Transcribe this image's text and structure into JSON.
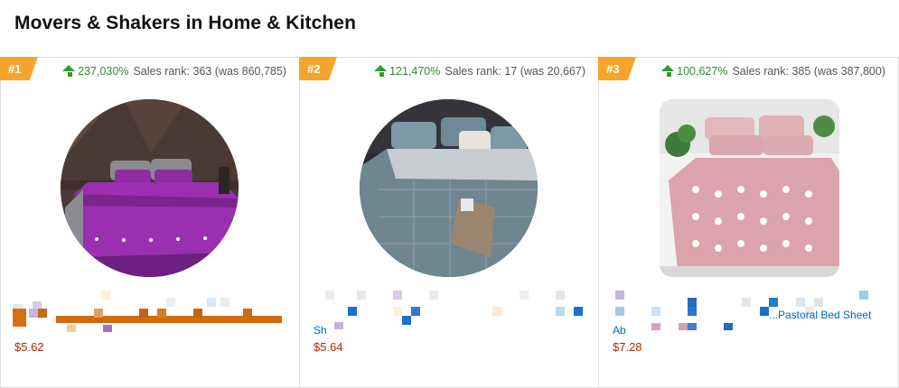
{
  "section": {
    "title": "Movers & Shakers in Home & Kitchen"
  },
  "colors": {
    "badge": "#f7a42c",
    "up_arrow": "#2e9c2e",
    "price": "#b12704",
    "link": "#0066c0"
  },
  "cards": [
    {
      "rank": "#1",
      "icon": "up-arrow-icon",
      "percent": "237,030%",
      "sales_rank": "Sales rank: 363 (was 860,785)",
      "price": "$5.62",
      "image": "purple-duvet-bedding-set"
    },
    {
      "rank": "#2",
      "icon": "up-arrow-icon",
      "percent": "121,470%",
      "sales_rank": "Sales rank: 17 (was 20,667)",
      "title_fragment": "Sh",
      "price": "$5.64",
      "image": "grey-plaid-bedding-set"
    },
    {
      "rank": "#3",
      "icon": "up-arrow-icon",
      "percent": "100,627%",
      "sales_rank": "Sales rank: 385 (was 387,800)",
      "title_fragment_start": "Ab",
      "title_fragment_end": "...Pastoral Bed Sheet",
      "price": "$7.28",
      "image": "pink-heart-bedding-set"
    }
  ]
}
